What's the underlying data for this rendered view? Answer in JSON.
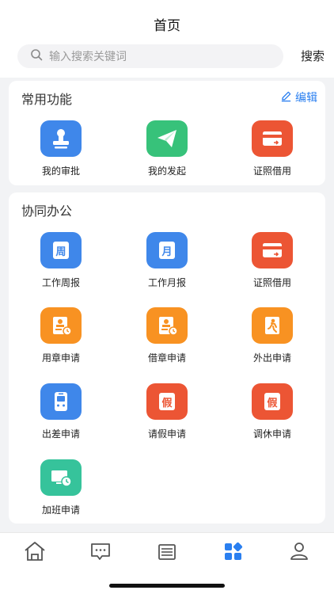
{
  "header": {
    "title": "首页"
  },
  "search": {
    "placeholder": "输入搜索关键词",
    "button": "搜索"
  },
  "common": {
    "title": "常用功能",
    "edit_label": "编辑",
    "items": [
      {
        "label": "我的审批",
        "icon": "stamp-icon"
      },
      {
        "label": "我的发起",
        "icon": "paper-plane-icon"
      },
      {
        "label": "证照借用",
        "icon": "card-icon"
      }
    ]
  },
  "office": {
    "title": "协同办公",
    "items": [
      {
        "label": "工作周报",
        "icon": "week-icon",
        "glyph": "周"
      },
      {
        "label": "工作月报",
        "icon": "month-icon",
        "glyph": "月"
      },
      {
        "label": "证照借用",
        "icon": "card-icon"
      },
      {
        "label": "用章申请",
        "icon": "stamp-apply-icon"
      },
      {
        "label": "借章申请",
        "icon": "stamp-borrow-icon"
      },
      {
        "label": "外出申请",
        "icon": "go-out-icon"
      },
      {
        "label": "出差申请",
        "icon": "train-icon"
      },
      {
        "label": "请假申请",
        "icon": "leave-icon",
        "glyph": "假"
      },
      {
        "label": "调休申请",
        "icon": "rest-icon",
        "glyph": "假"
      },
      {
        "label": "加班申请",
        "icon": "overtime-icon"
      }
    ]
  },
  "colors": {
    "accent": "#2a7ff0",
    "active_tab": "#2a7ff0"
  },
  "tabbar": {
    "items": [
      {
        "icon": "home-icon"
      },
      {
        "icon": "message-icon"
      },
      {
        "icon": "list-icon"
      },
      {
        "icon": "apps-icon",
        "active": true
      },
      {
        "icon": "user-icon"
      }
    ]
  }
}
